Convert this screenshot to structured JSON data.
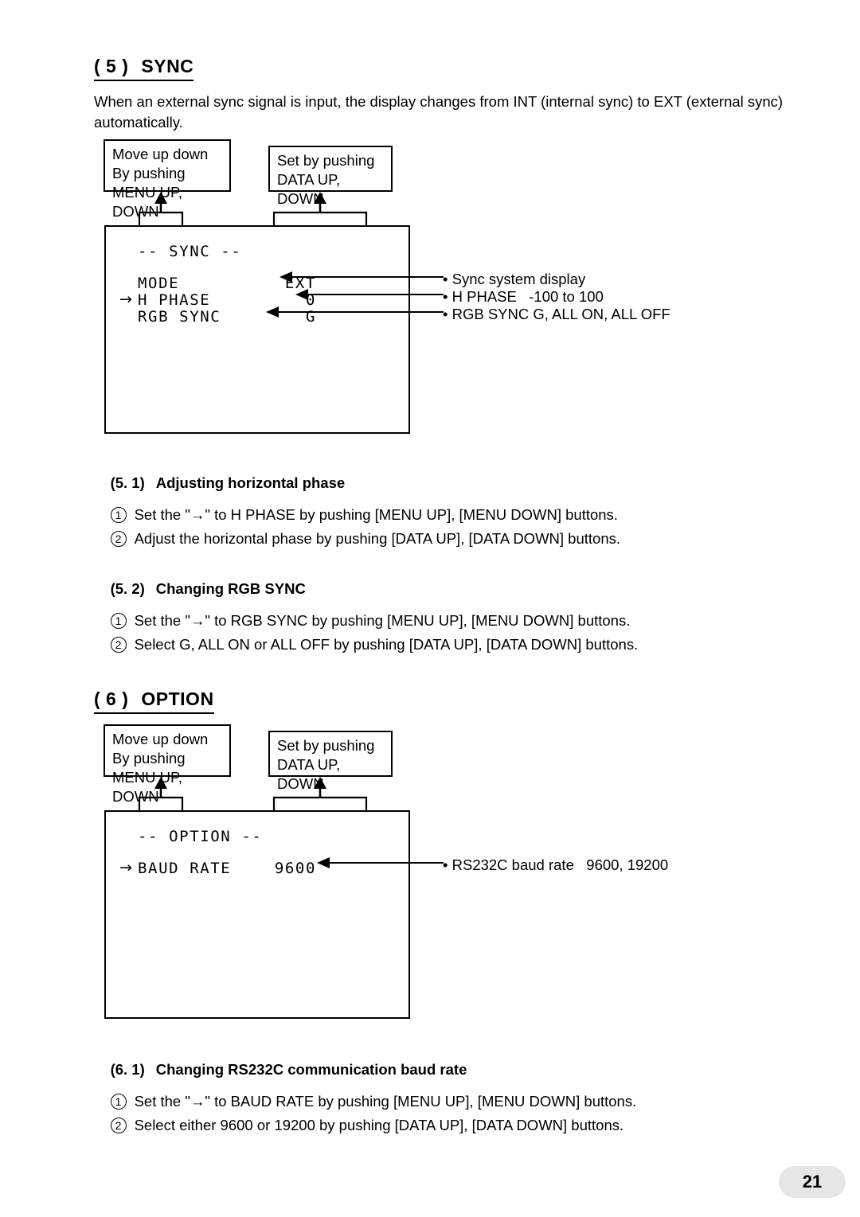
{
  "document": {
    "page_number": "21"
  },
  "sections": [
    {
      "number": "( 5 )",
      "title": "SYNC",
      "intro": "When an external sync signal is input, the display changes from INT (internal sync) to EXT (external sync)\nautomatically.",
      "callouts": {
        "left": "Move up down\nBy pushing\nMENU UP, DOWN",
        "right": "Set by pushing\nDATA UP, DOWN"
      },
      "display": {
        "title": "-- SYNC --",
        "rows": [
          {
            "cursor": "",
            "label": "MODE",
            "value": "EXT"
          },
          {
            "cursor": "→",
            "label": "H PHASE",
            "value": "0"
          },
          {
            "cursor": "",
            "label": "RGB SYNC",
            "value": "G"
          }
        ]
      },
      "annotations": [
        "• Sync system display",
        "• H PHASE   -100 to 100",
        "• RGB SYNC G, ALL ON, ALL OFF"
      ],
      "subsections": [
        {
          "number": "(5. 1)",
          "title": "Adjusting horizontal phase",
          "steps": [
            {
              "num": "1",
              "text": "Set the \"→\" to H PHASE by pushing [MENU UP], [MENU DOWN] buttons."
            },
            {
              "num": "2",
              "text": "Adjust the horizontal phase by pushing [DATA UP], [DATA DOWN] buttons."
            }
          ]
        },
        {
          "number": "(5. 2)",
          "title": "Changing RGB SYNC",
          "steps": [
            {
              "num": "1",
              "text": "Set the \"→\" to RGB SYNC by pushing [MENU UP], [MENU DOWN] buttons."
            },
            {
              "num": "2",
              "text": "Select G, ALL ON or ALL OFF by pushing [DATA UP], [DATA DOWN] buttons."
            }
          ]
        }
      ]
    },
    {
      "number": "( 6 )",
      "title": "OPTION",
      "callouts": {
        "left": "Move up down\nBy pushing\nMENU UP, DOWN",
        "right": "Set by pushing\nDATA UP, DOWN"
      },
      "display": {
        "title": "-- OPTION --",
        "rows": [
          {
            "cursor": "→",
            "label": "BAUD RATE",
            "value": "9600"
          }
        ]
      },
      "annotations": [
        "• RS232C baud rate   9600, 19200"
      ],
      "subsections": [
        {
          "number": "(6. 1)",
          "title": "Changing RS232C communication baud rate",
          "steps": [
            {
              "num": "1",
              "text": "Set the \"→\" to BAUD RATE by pushing [MENU UP], [MENU DOWN] buttons."
            },
            {
              "num": "2",
              "text": "Select either 9600 or 19200 by pushing [DATA UP], [DATA DOWN] buttons."
            }
          ]
        }
      ]
    }
  ]
}
